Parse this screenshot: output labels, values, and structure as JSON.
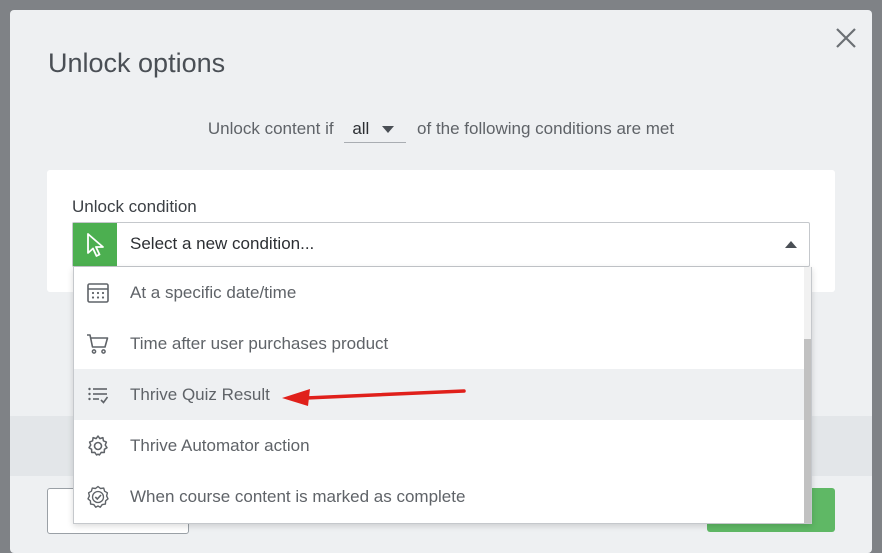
{
  "modal": {
    "title": "Unlock options",
    "unlock_prefix": "Unlock content if",
    "match_mode": "all",
    "unlock_suffix": "of the following conditions are met",
    "condition_label": "Unlock condition",
    "select_placeholder": "Select a new condition...",
    "accent_color": "#4caf50"
  },
  "dropdown": {
    "items": [
      {
        "label": "At a specific date/time",
        "icon": "calendar-icon"
      },
      {
        "label": "Time after user purchases product",
        "icon": "cart-icon"
      },
      {
        "label": "Thrive Quiz Result",
        "icon": "quiz-list-icon",
        "highlighted": true
      },
      {
        "label": "Thrive Automator action",
        "icon": "gear-icon"
      },
      {
        "label": "When course content is marked as complete",
        "icon": "badge-check-icon"
      }
    ]
  },
  "annotation": {
    "arrow_color": "#e0201b",
    "points_to": "Thrive Quiz Result"
  }
}
